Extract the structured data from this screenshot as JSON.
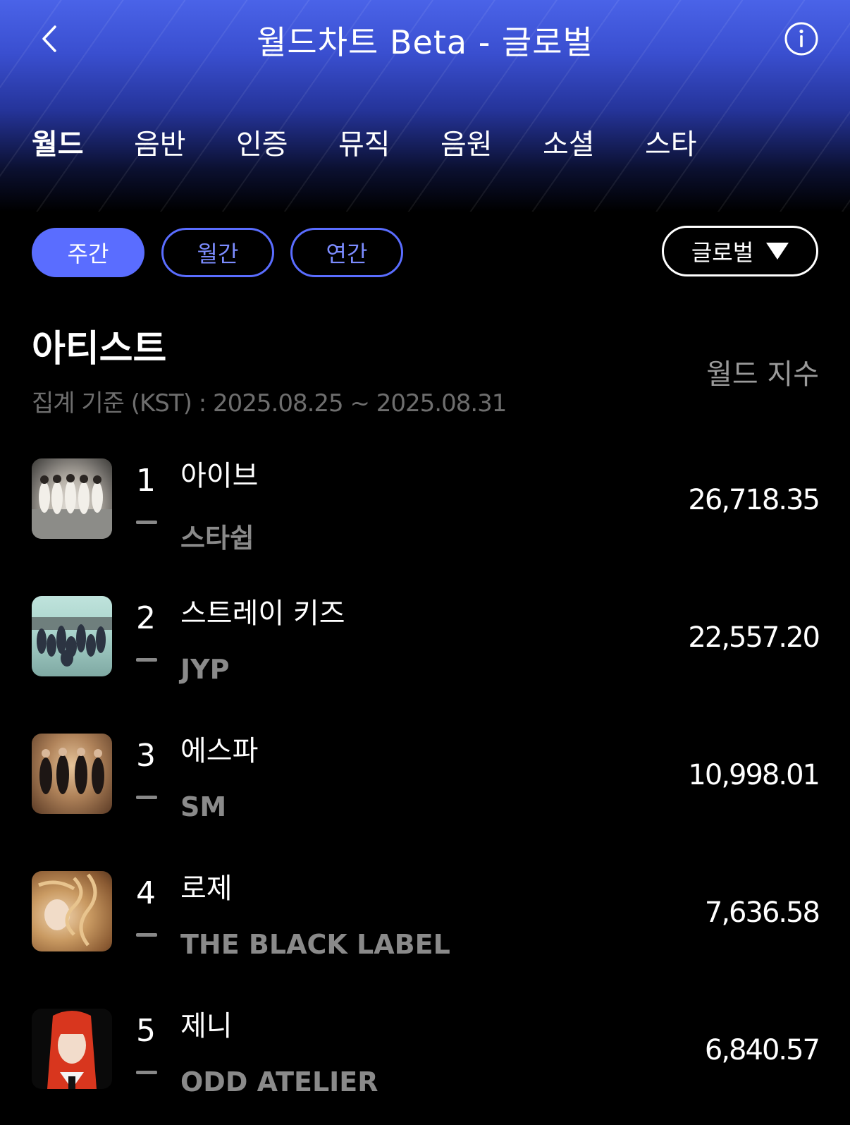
{
  "header": {
    "title": "월드차트 Beta - 글로벌",
    "back_icon": "chevron-left-icon",
    "info_icon": "info-circle-icon"
  },
  "tabs": [
    {
      "label": "월드",
      "active": true
    },
    {
      "label": "음반",
      "active": false
    },
    {
      "label": "인증",
      "active": false
    },
    {
      "label": "뮤직",
      "active": false
    },
    {
      "label": "음원",
      "active": false
    },
    {
      "label": "소셜",
      "active": false
    },
    {
      "label": "스타",
      "active": false
    }
  ],
  "period_filters": [
    {
      "label": "주간",
      "active": true
    },
    {
      "label": "월간",
      "active": false
    },
    {
      "label": "연간",
      "active": false
    }
  ],
  "region_select": {
    "value": "글로벌",
    "icon": "triangle-down-icon"
  },
  "section": {
    "title": "아티스트",
    "period": "집계 기준 (KST) : 2025.08.25 ~ 2025.08.31",
    "metric_label": "월드 지수"
  },
  "artists": [
    {
      "rank": "1",
      "name": "아이브",
      "agency": "스타쉽",
      "score": "26,718.35"
    },
    {
      "rank": "2",
      "name": "스트레이 키즈",
      "agency": "JYP",
      "score": "22,557.20"
    },
    {
      "rank": "3",
      "name": "에스파",
      "agency": "SM",
      "score": "10,998.01"
    },
    {
      "rank": "4",
      "name": "로제",
      "agency": "THE BLACK LABEL",
      "score": "7,636.58"
    },
    {
      "rank": "5",
      "name": "제니",
      "agency": "ODD ATELIER",
      "score": "6,840.57"
    }
  ],
  "colors": {
    "accent": "#5a6dff",
    "header_top": "#4a63e8",
    "background": "#000000",
    "muted_text": "#8a8a8a"
  }
}
